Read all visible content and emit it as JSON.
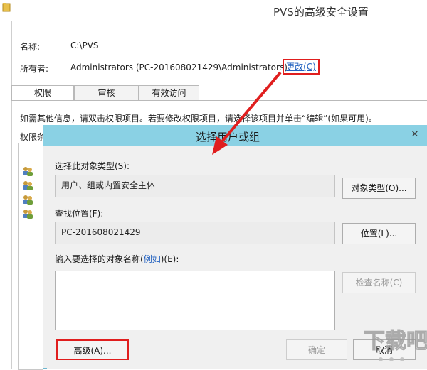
{
  "parent": {
    "title": "PVS的高级安全设置",
    "name_label": "名称:",
    "name_value": "C:\\PVS",
    "owner_label": "所有者:",
    "owner_value": "Administrators (PC-201608021429\\Administrators)",
    "change_link": "更改(C)",
    "tabs": [
      {
        "label": "权限"
      },
      {
        "label": "审核"
      },
      {
        "label": "有效访问"
      }
    ],
    "info_text": "如需其他信息，请双击权限项目。若要修改权限项目，请选择该项目并单击“编辑”(如果可用)。",
    "entries_label": "权限条"
  },
  "dialog": {
    "title": "选择用户或组",
    "close_glyph": "✕",
    "object_type_label": "选择此对象类型(S):",
    "object_type_value": "用户、组或内置安全主体",
    "object_type_button": "对象类型(O)...",
    "location_label": "查找位置(F):",
    "location_value": "PC-201608021429",
    "location_button": "位置(L)...",
    "names_label_prefix": "输入要选择的对象名称(",
    "names_label_link": "例如",
    "names_label_suffix": ")(E):",
    "names_value": "",
    "check_names_button": "检查名称(C)",
    "advanced_button": "高级(A)...",
    "ok_button": "确定",
    "cancel_button": "取消"
  },
  "colors": {
    "dialog_titlebar": "#8ad1e4",
    "highlight_red": "#e01e1e",
    "link_blue": "#1f5fbf"
  },
  "watermark": {
    "text": "下载吧"
  }
}
